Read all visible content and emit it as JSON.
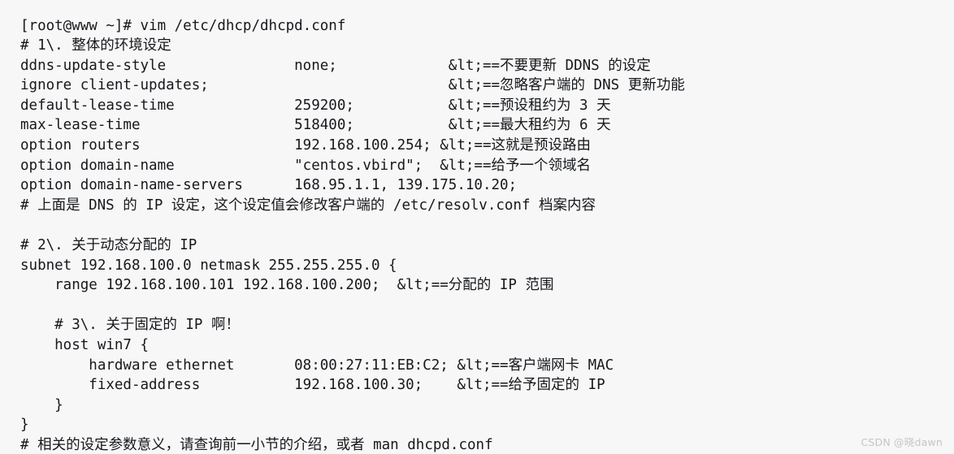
{
  "window": {
    "title": "vim /etc/dhcp/dhcpd.conf",
    "background_color": "#f7f7f7",
    "text_color": "#16181c"
  },
  "terminal": {
    "lines": [
      "[root@www ~]# vim /etc/dhcp/dhcpd.conf",
      "# 1\\. 整体的环境设定",
      "ddns-update-style               none;             &lt;==不要更新 DDNS 的设定",
      "ignore client-updates;                            &lt;==忽略客户端的 DNS 更新功能",
      "default-lease-time              259200;           &lt;==预设租约为 3 天",
      "max-lease-time                  518400;           &lt;==最大租约为 6 天",
      "option routers                  192.168.100.254; &lt;==这就是预设路由",
      "option domain-name              \"centos.vbird\";  &lt;==给予一个领域名",
      "option domain-name-servers      168.95.1.1, 139.175.10.20;",
      "# 上面是 DNS 的 IP 设定，这个设定值会修改客户端的 /etc/resolv.conf 档案内容",
      "",
      "# 2\\. 关于动态分配的 IP",
      "subnet 192.168.100.0 netmask 255.255.255.0 {",
      "    range 192.168.100.101 192.168.100.200;  &lt;==分配的 IP 范围",
      "",
      "    # 3\\. 关于固定的 IP 啊！",
      "    host win7 {",
      "        hardware ethernet       08:00:27:11:EB:C2; &lt;==客户端网卡 MAC",
      "        fixed-address           192.168.100.30;    &lt;==给予固定的 IP",
      "    }",
      "}",
      "# 相关的设定参数意义，请查询前一小节的介绍，或者 man dhcpd.conf"
    ]
  },
  "watermark": {
    "text": "CSDN @晓dawn",
    "color": "#c3c5c9"
  }
}
